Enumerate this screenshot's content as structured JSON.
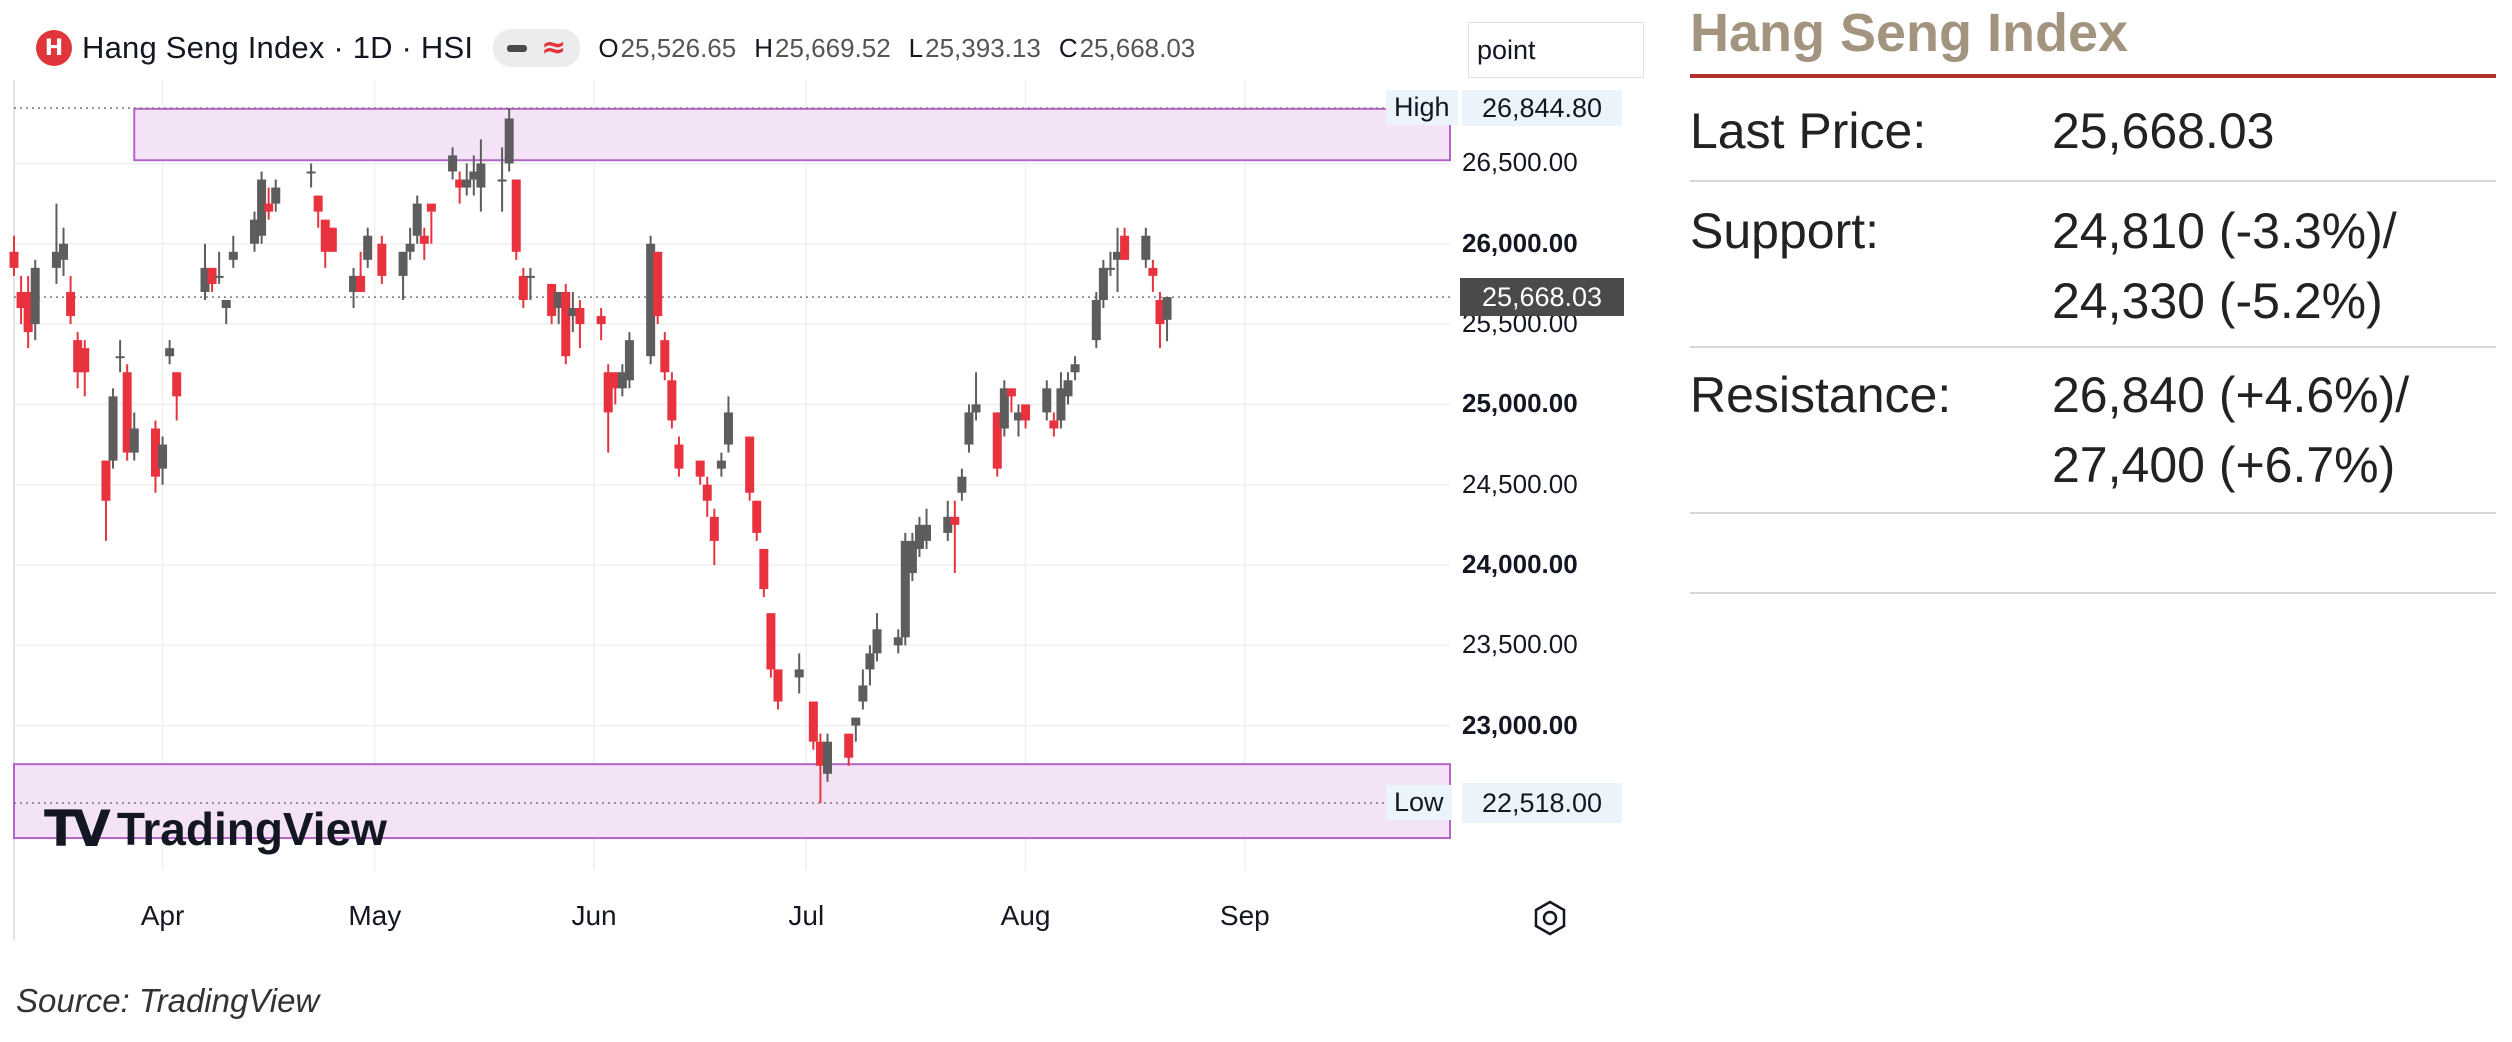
{
  "header": {
    "logo_glyph": "H",
    "symbol": "Hang Seng Index · 1D · HSI",
    "open_label": "O",
    "open": "25,526.65",
    "high_label": "H",
    "high": "25,669.52",
    "low_label": "L",
    "low": "25,393.13",
    "close_label": "C",
    "close": "25,668.03"
  },
  "point_input": "point",
  "watermark": "TradingView",
  "source": "Source: TradingView",
  "colors": {
    "up": "#5d5d5d",
    "down": "#e8333f",
    "zone_fill": "#f4e3f7",
    "zone_stroke": "#b565c9",
    "panel_accent": "#b2302d",
    "title_color": "#a39480"
  },
  "chart_data": {
    "type": "candlestick",
    "title": "Hang Seng Index · 1D · HSI",
    "y_range": [
      22400,
      26920
    ],
    "y_ticks": [
      {
        "value": 26500,
        "label": "26,500.00",
        "bold": false
      },
      {
        "value": 26000,
        "label": "26,000.00",
        "bold": true
      },
      {
        "value": 25500,
        "label": "25,500.00",
        "bold": false
      },
      {
        "value": 25000,
        "label": "25,000.00",
        "bold": true
      },
      {
        "value": 24500,
        "label": "24,500.00",
        "bold": false
      },
      {
        "value": 24000,
        "label": "24,000.00",
        "bold": true
      },
      {
        "value": 23500,
        "label": "23,500.00",
        "bold": false
      },
      {
        "value": 23000,
        "label": "23,000.00",
        "bold": true
      }
    ],
    "months": [
      {
        "label": "Apr",
        "date": "2025-04-01"
      },
      {
        "label": "May",
        "date": "2025-05-01"
      },
      {
        "label": "Jun",
        "date": "2025-06-01"
      },
      {
        "label": "Jul",
        "date": "2025-07-01"
      },
      {
        "label": "Aug",
        "date": "2025-08-01"
      },
      {
        "label": "Sep",
        "date": "2025-09-01"
      }
    ],
    "x_range": [
      "2025-03-11",
      "2025-09-30"
    ],
    "last_price": {
      "value": 25668.03,
      "label": "25,668.03"
    },
    "high_line": {
      "value": 26844.8,
      "label": "26,844.80",
      "tag": "High"
    },
    "low_line": {
      "value": 22518.0,
      "label": "22,518.00",
      "tag": "Low"
    },
    "zones": [
      {
        "name": "resistance-zone",
        "from": "2025-03-28",
        "to": "2025-09-30",
        "top": 26840,
        "bottom": 26520
      },
      {
        "name": "support-zone",
        "from": "2025-03-11",
        "to": "2025-09-30",
        "top": 22760,
        "bottom": 22300
      }
    ],
    "candles": [
      {
        "date": "2025-03-11",
        "o": 25950,
        "h": 26050,
        "l": 25800,
        "c": 25850
      },
      {
        "date": "2025-03-12",
        "o": 25700,
        "h": 25800,
        "l": 25500,
        "c": 25600
      },
      {
        "date": "2025-03-13",
        "o": 25700,
        "h": 25800,
        "l": 25350,
        "c": 25450
      },
      {
        "date": "2025-03-14",
        "o": 25500,
        "h": 25900,
        "l": 25400,
        "c": 25850
      },
      {
        "date": "2025-03-17",
        "o": 25850,
        "h": 26250,
        "l": 25750,
        "c": 25950
      },
      {
        "date": "2025-03-18",
        "o": 25900,
        "h": 26100,
        "l": 25800,
        "c": 26000
      },
      {
        "date": "2025-03-19",
        "o": 25700,
        "h": 25800,
        "l": 25500,
        "c": 25550
      },
      {
        "date": "2025-03-20",
        "o": 25400,
        "h": 25450,
        "l": 25100,
        "c": 25200
      },
      {
        "date": "2025-03-21",
        "o": 25350,
        "h": 25400,
        "l": 25050,
        "c": 25200
      },
      {
        "date": "2025-03-24",
        "o": 24650,
        "h": 24650,
        "l": 24150,
        "c": 24400
      },
      {
        "date": "2025-03-25",
        "o": 24650,
        "h": 25100,
        "l": 24600,
        "c": 25050
      },
      {
        "date": "2025-03-26",
        "o": 25300,
        "h": 25400,
        "l": 25200,
        "c": 25300
      },
      {
        "date": "2025-03-27",
        "o": 25200,
        "h": 25250,
        "l": 24650,
        "c": 24700
      },
      {
        "date": "2025-03-28",
        "o": 24700,
        "h": 24950,
        "l": 24650,
        "c": 24850
      },
      {
        "date": "2025-03-31",
        "o": 24850,
        "h": 24900,
        "l": 24450,
        "c": 24550
      },
      {
        "date": "2025-04-01",
        "o": 24600,
        "h": 24800,
        "l": 24500,
        "c": 24750
      },
      {
        "date": "2025-04-02",
        "o": 25300,
        "h": 25400,
        "l": 25250,
        "c": 25350
      },
      {
        "date": "2025-04-03",
        "o": 25200,
        "h": 25200,
        "l": 24900,
        "c": 25050
      },
      {
        "date": "2025-04-07",
        "o": 25700,
        "h": 26000,
        "l": 25650,
        "c": 25850
      },
      {
        "date": "2025-04-08",
        "o": 25850,
        "h": 25850,
        "l": 25700,
        "c": 25750
      },
      {
        "date": "2025-04-09",
        "o": 25800,
        "h": 25950,
        "l": 25750,
        "c": 25800
      },
      {
        "date": "2025-04-10",
        "o": 25600,
        "h": 25650,
        "l": 25500,
        "c": 25650
      },
      {
        "date": "2025-04-11",
        "o": 25900,
        "h": 26050,
        "l": 25850,
        "c": 25950
      },
      {
        "date": "2025-04-14",
        "o": 26000,
        "h": 26200,
        "l": 25950,
        "c": 26150
      },
      {
        "date": "2025-04-15",
        "o": 26050,
        "h": 26450,
        "l": 26000,
        "c": 26400
      },
      {
        "date": "2025-04-16",
        "o": 26250,
        "h": 26350,
        "l": 26150,
        "c": 26200
      },
      {
        "date": "2025-04-17",
        "o": 26250,
        "h": 26400,
        "l": 26200,
        "c": 26350
      },
      {
        "date": "2025-04-22",
        "o": 26450,
        "h": 26500,
        "l": 26350,
        "c": 26450
      },
      {
        "date": "2025-04-23",
        "o": 26300,
        "h": 26300,
        "l": 26100,
        "c": 26200
      },
      {
        "date": "2025-04-24",
        "o": 26150,
        "h": 26150,
        "l": 25850,
        "c": 25950
      },
      {
        "date": "2025-04-25",
        "o": 26100,
        "h": 26100,
        "l": 25950,
        "c": 25950
      },
      {
        "date": "2025-04-28",
        "o": 25700,
        "h": 25850,
        "l": 25600,
        "c": 25800
      },
      {
        "date": "2025-04-29",
        "o": 25800,
        "h": 25950,
        "l": 25700,
        "c": 25700
      },
      {
        "date": "2025-04-30",
        "o": 25900,
        "h": 26100,
        "l": 25850,
        "c": 26050
      },
      {
        "date": "2025-05-02",
        "o": 26000,
        "h": 26050,
        "l": 25750,
        "c": 25800
      },
      {
        "date": "2025-05-05",
        "o": 25800,
        "h": 25900,
        "l": 25650,
        "c": 25950
      },
      {
        "date": "2025-05-06",
        "o": 25950,
        "h": 26100,
        "l": 25900,
        "c": 26000
      },
      {
        "date": "2025-05-07",
        "o": 26050,
        "h": 26300,
        "l": 26000,
        "c": 26250
      },
      {
        "date": "2025-05-08",
        "o": 26050,
        "h": 26100,
        "l": 25900,
        "c": 26000
      },
      {
        "date": "2025-05-09",
        "o": 26250,
        "h": 26200,
        "l": 26000,
        "c": 26200
      },
      {
        "date": "2025-05-12",
        "o": 26450,
        "h": 26600,
        "l": 26400,
        "c": 26550
      },
      {
        "date": "2025-05-13",
        "o": 26400,
        "h": 26450,
        "l": 26250,
        "c": 26350
      },
      {
        "date": "2025-05-14",
        "o": 26350,
        "h": 26500,
        "l": 26300,
        "c": 26400
      },
      {
        "date": "2025-05-15",
        "o": 26400,
        "h": 26550,
        "l": 26300,
        "c": 26450
      },
      {
        "date": "2025-05-16",
        "o": 26350,
        "h": 26650,
        "l": 26200,
        "c": 26500
      },
      {
        "date": "2025-05-19",
        "o": 26400,
        "h": 26600,
        "l": 26200,
        "c": 26400
      },
      {
        "date": "2025-05-20",
        "o": 26500,
        "h": 26845,
        "l": 26450,
        "c": 26780
      },
      {
        "date": "2025-05-21",
        "o": 26400,
        "h": 26400,
        "l": 25900,
        "c": 25950
      },
      {
        "date": "2025-05-22",
        "o": 25800,
        "h": 25850,
        "l": 25600,
        "c": 25650
      },
      {
        "date": "2025-05-23",
        "o": 25800,
        "h": 25850,
        "l": 25650,
        "c": 25800
      },
      {
        "date": "2025-05-26",
        "o": 25750,
        "h": 25750,
        "l": 25500,
        "c": 25550
      },
      {
        "date": "2025-05-27",
        "o": 25600,
        "h": 25700,
        "l": 25500,
        "c": 25700
      },
      {
        "date": "2025-05-28",
        "o": 25700,
        "h": 25750,
        "l": 25250,
        "c": 25300
      },
      {
        "date": "2025-05-29",
        "o": 25550,
        "h": 25700,
        "l": 25450,
        "c": 25600
      },
      {
        "date": "2025-05-30",
        "o": 25600,
        "h": 25650,
        "l": 25350,
        "c": 25500
      },
      {
        "date": "2025-06-02",
        "o": 25550,
        "h": 25600,
        "l": 25400,
        "c": 25500
      },
      {
        "date": "2025-06-03",
        "o": 25200,
        "h": 25250,
        "l": 24700,
        "c": 24950
      },
      {
        "date": "2025-06-04",
        "o": 25200,
        "h": 25200,
        "l": 25000,
        "c": 25100
      },
      {
        "date": "2025-06-05",
        "o": 25100,
        "h": 25250,
        "l": 25050,
        "c": 25200
      },
      {
        "date": "2025-06-06",
        "o": 25150,
        "h": 25450,
        "l": 25100,
        "c": 25400
      },
      {
        "date": "2025-06-09",
        "o": 25300,
        "h": 26050,
        "l": 25250,
        "c": 26000
      },
      {
        "date": "2025-06-10",
        "o": 25950,
        "h": 25950,
        "l": 25500,
        "c": 25550
      },
      {
        "date": "2025-06-11",
        "o": 25400,
        "h": 25450,
        "l": 25150,
        "c": 25200
      },
      {
        "date": "2025-06-12",
        "o": 25150,
        "h": 25200,
        "l": 24850,
        "c": 24900
      },
      {
        "date": "2025-06-13",
        "o": 24750,
        "h": 24800,
        "l": 24550,
        "c": 24600
      },
      {
        "date": "2025-06-16",
        "o": 24650,
        "h": 24650,
        "l": 24500,
        "c": 24550
      },
      {
        "date": "2025-06-17",
        "o": 24500,
        "h": 24550,
        "l": 24300,
        "c": 24400
      },
      {
        "date": "2025-06-18",
        "o": 24300,
        "h": 24350,
        "l": 24000,
        "c": 24150
      },
      {
        "date": "2025-06-19",
        "o": 24600,
        "h": 24700,
        "l": 24550,
        "c": 24650
      },
      {
        "date": "2025-06-20",
        "o": 24750,
        "h": 25050,
        "l": 24700,
        "c": 24950
      },
      {
        "date": "2025-06-23",
        "o": 24800,
        "h": 24800,
        "l": 24400,
        "c": 24450
      },
      {
        "date": "2025-06-24",
        "o": 24400,
        "h": 24400,
        "l": 24150,
        "c": 24200
      },
      {
        "date": "2025-06-25",
        "o": 24100,
        "h": 24100,
        "l": 23800,
        "c": 23850
      },
      {
        "date": "2025-06-26",
        "o": 23700,
        "h": 23700,
        "l": 23300,
        "c": 23350
      },
      {
        "date": "2025-06-27",
        "o": 23350,
        "h": 23350,
        "l": 23100,
        "c": 23150
      },
      {
        "date": "2025-06-30",
        "o": 23300,
        "h": 23450,
        "l": 23200,
        "c": 23350
      },
      {
        "date": "2025-07-02",
        "o": 23150,
        "h": 23150,
        "l": 22850,
        "c": 22900
      },
      {
        "date": "2025-07-03",
        "o": 22900,
        "h": 22950,
        "l": 22518,
        "c": 22750
      },
      {
        "date": "2025-07-04",
        "o": 22700,
        "h": 22950,
        "l": 22650,
        "c": 22900
      },
      {
        "date": "2025-07-07",
        "o": 22950,
        "h": 22950,
        "l": 22750,
        "c": 22800
      },
      {
        "date": "2025-07-08",
        "o": 23000,
        "h": 23050,
        "l": 22900,
        "c": 23050
      },
      {
        "date": "2025-07-09",
        "o": 23150,
        "h": 23350,
        "l": 23100,
        "c": 23250
      },
      {
        "date": "2025-07-10",
        "o": 23350,
        "h": 23500,
        "l": 23250,
        "c": 23450
      },
      {
        "date": "2025-07-11",
        "o": 23450,
        "h": 23700,
        "l": 23400,
        "c": 23600
      },
      {
        "date": "2025-07-14",
        "o": 23500,
        "h": 23600,
        "l": 23450,
        "c": 23550
      },
      {
        "date": "2025-07-15",
        "o": 23550,
        "h": 24200,
        "l": 23500,
        "c": 24150
      },
      {
        "date": "2025-07-16",
        "o": 23950,
        "h": 24200,
        "l": 23900,
        "c": 24150
      },
      {
        "date": "2025-07-17",
        "o": 24100,
        "h": 24300,
        "l": 24050,
        "c": 24250
      },
      {
        "date": "2025-07-18",
        "o": 24150,
        "h": 24350,
        "l": 24100,
        "c": 24250
      },
      {
        "date": "2025-07-21",
        "o": 24200,
        "h": 24400,
        "l": 24150,
        "c": 24300
      },
      {
        "date": "2025-07-22",
        "o": 24300,
        "h": 24400,
        "l": 23950,
        "c": 24250
      },
      {
        "date": "2025-07-23",
        "o": 24450,
        "h": 24600,
        "l": 24400,
        "c": 24550
      },
      {
        "date": "2025-07-24",
        "o": 24750,
        "h": 25000,
        "l": 24700,
        "c": 24950
      },
      {
        "date": "2025-07-25",
        "o": 24950,
        "h": 25200,
        "l": 24900,
        "c": 25000
      },
      {
        "date": "2025-07-28",
        "o": 24950,
        "h": 24950,
        "l": 24550,
        "c": 24600
      },
      {
        "date": "2025-07-29",
        "o": 24850,
        "h": 25150,
        "l": 24800,
        "c": 25100
      },
      {
        "date": "2025-07-30",
        "o": 25100,
        "h": 25100,
        "l": 24950,
        "c": 25050
      },
      {
        "date": "2025-07-31",
        "o": 24900,
        "h": 25000,
        "l": 24800,
        "c": 24950
      },
      {
        "date": "2025-08-01",
        "o": 25000,
        "h": 25000,
        "l": 24850,
        "c": 24900
      },
      {
        "date": "2025-08-04",
        "o": 24950,
        "h": 25150,
        "l": 24900,
        "c": 25100
      },
      {
        "date": "2025-08-05",
        "o": 24900,
        "h": 24950,
        "l": 24800,
        "c": 24850
      },
      {
        "date": "2025-08-06",
        "o": 24900,
        "h": 25200,
        "l": 24850,
        "c": 25100
      },
      {
        "date": "2025-08-07",
        "o": 25050,
        "h": 25200,
        "l": 25000,
        "c": 25150
      },
      {
        "date": "2025-08-08",
        "o": 25200,
        "h": 25300,
        "l": 25150,
        "c": 25250
      },
      {
        "date": "2025-08-11",
        "o": 25400,
        "h": 25700,
        "l": 25350,
        "c": 25650
      },
      {
        "date": "2025-08-12",
        "o": 25650,
        "h": 25900,
        "l": 25600,
        "c": 25850
      },
      {
        "date": "2025-08-13",
        "o": 25850,
        "h": 25950,
        "l": 25800,
        "c": 25850
      },
      {
        "date": "2025-08-14",
        "o": 25900,
        "h": 26100,
        "l": 25700,
        "c": 25950
      },
      {
        "date": "2025-08-15",
        "o": 26050,
        "h": 26100,
        "l": 25900,
        "c": 25900
      },
      {
        "date": "2025-08-18",
        "o": 25900,
        "h": 26100,
        "l": 25850,
        "c": 26050
      },
      {
        "date": "2025-08-19",
        "o": 25850,
        "h": 25900,
        "l": 25700,
        "c": 25800
      },
      {
        "date": "2025-08-20",
        "o": 25650,
        "h": 25700,
        "l": 25350,
        "c": 25500
      },
      {
        "date": "2025-08-21",
        "o": 25526.65,
        "h": 25669.52,
        "l": 25393.13,
        "c": 25668.03
      }
    ]
  },
  "panel": {
    "title": "Hang Seng Index",
    "rows": [
      {
        "key": "Last Price:",
        "values": [
          "25,668.03"
        ]
      },
      {
        "key": "Support:",
        "values": [
          "24,810 (-3.3%)/",
          "24,330 (-5.2%)"
        ]
      },
      {
        "key": "Resistance:",
        "values": [
          "26,840 (+4.6%)/",
          "27,400 (+6.7%)"
        ]
      }
    ]
  }
}
